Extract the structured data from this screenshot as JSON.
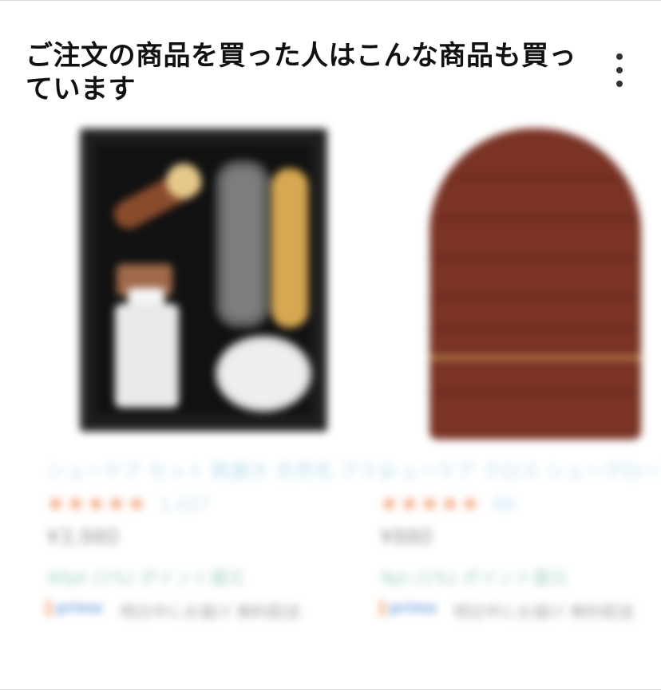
{
  "widget": {
    "title": "ご注文の商品を買った人はこんな商品も買っています",
    "more_icon": "more-vertical-icon"
  },
  "products": [
    {
      "title": "シューケア セット 靴磨き 天然毛 ブラシ",
      "rating_stars": "★★★★★",
      "rating_value": 4.5,
      "review_count": "1,427",
      "price": "¥3,980",
      "points": "40pt (1%) ポイント還元",
      "badge": "prime",
      "delivery": "明日中にお届け 無料配送"
    },
    {
      "title": "シューケア クロス シューグローブ",
      "rating_stars": "★★★★★",
      "rating_value": 4.5,
      "review_count": "86",
      "price": "¥880",
      "points": "9pt (1%) ポイント還元",
      "badge": "prime",
      "delivery": "明日中にお届け 無料配送"
    }
  ],
  "colors": {
    "star": "#f39a6d",
    "link": "#bfe0f0",
    "prime": "#7fa9e3",
    "points": "#a8d3c5",
    "mitt": "#7a3325"
  }
}
